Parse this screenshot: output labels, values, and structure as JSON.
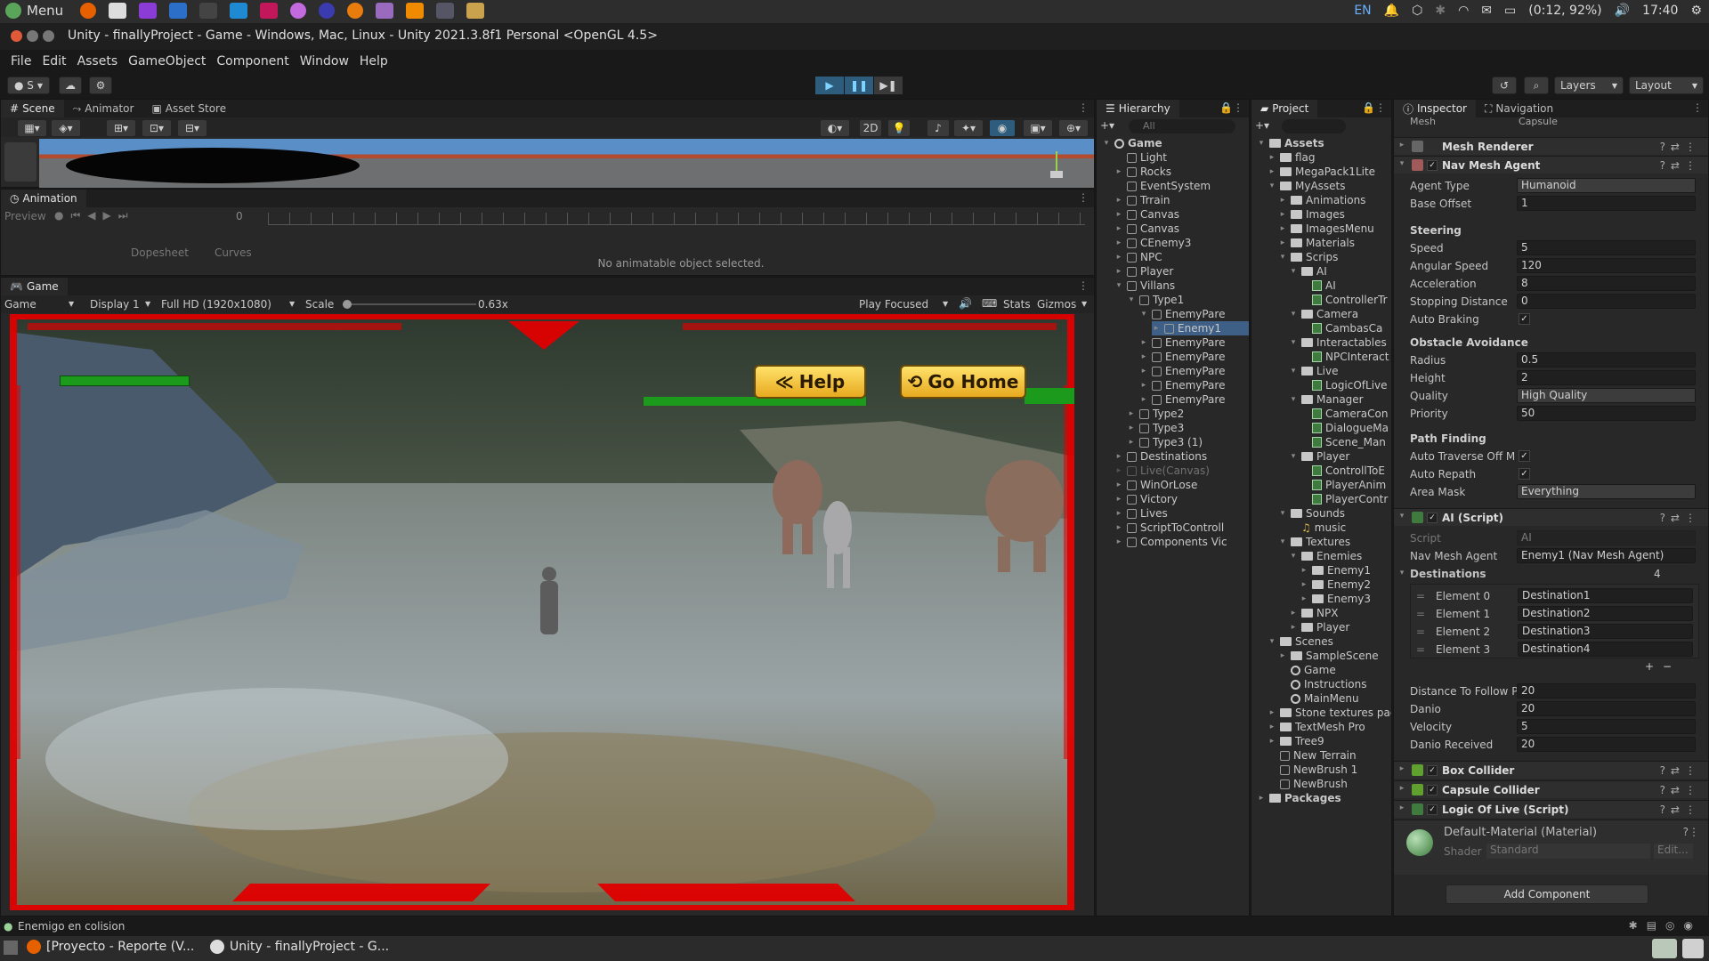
{
  "os": {
    "menu_label": "Menu",
    "tray": {
      "lang": "EN",
      "battery": "(0:12, 92%)",
      "time": "17:40"
    }
  },
  "window": {
    "title": "Unity - finallyProject - Game - Windows, Mac, Linux - Unity 2021.3.8f1 Personal <OpenGL 4.5>"
  },
  "menu": [
    "File",
    "Edit",
    "Assets",
    "GameObject",
    "Component",
    "Window",
    "Help"
  ],
  "toolbar": {
    "account": "S",
    "layers": "Layers",
    "layout": "Layout"
  },
  "scene_panel": {
    "tabs": [
      "Scene",
      "Animator",
      "Asset Store"
    ],
    "mode_2d": "2D"
  },
  "animation_panel": {
    "tab": "Animation",
    "preview": "Preview",
    "frame": "0",
    "dopesheet": "Dopesheet",
    "curves": "Curves",
    "message": "No animatable object selected."
  },
  "game_panel": {
    "tab": "Game",
    "view": "Game",
    "display": "Display 1",
    "resolution": "Full HD (1920x1080)",
    "scale_label": "Scale",
    "scale_value": "0.63x",
    "play_mode": "Play Focused",
    "stats": "Stats",
    "gizmos": "Gizmos",
    "help_button": "Help",
    "home_button": "Go Home"
  },
  "hierarchy": {
    "tab": "Hierarchy",
    "search_placeholder": "All",
    "items": [
      "Game",
      "Light",
      "Rocks",
      "EventSystem",
      "Trrain",
      "Canvas",
      "Canvas",
      "CEnemy3",
      "NPC",
      "Player",
      "Villans",
      "Type1",
      "EnemyPare",
      "Enemy1",
      "EnemyPare",
      "EnemyPare",
      "EnemyPare",
      "EnemyPare",
      "EnemyPare",
      "Type2",
      "Type3",
      "Type3 (1)",
      "Destinations",
      "Live(Canvas)",
      "WinOrLose",
      "Victory",
      "Lives",
      "ScriptToControll",
      "Components Vic"
    ]
  },
  "project": {
    "tab": "Project",
    "items": [
      "Assets",
      "flag",
      "MegaPack1Lite",
      "MyAssets",
      "Animations",
      "Images",
      "ImagesMenu",
      "Materials",
      "Scrips",
      "AI",
      "AI",
      "ControllerTr",
      "Camera",
      "CambasCa",
      "Interactables",
      "NPCInteract",
      "Live",
      "LogicOfLive",
      "Manager",
      "CameraCon",
      "DialogueMa",
      "Scene_Man",
      "Player",
      "ControllToE",
      "PlayerAnim",
      "PlayerContr",
      "Sounds",
      "music",
      "Textures",
      "Enemies",
      "Enemy1",
      "Enemy2",
      "Enemy3",
      "NPX",
      "Player",
      "Scenes",
      "SampleScene",
      "Game",
      "Instructions",
      "MainMenu",
      "Stone textures pack",
      "TextMesh Pro",
      "Tree9",
      "New Terrain",
      "NewBrush 1",
      "NewBrush",
      "Packages"
    ]
  },
  "inspector": {
    "tabs": [
      "Inspector",
      "Navigation"
    ],
    "mesh_label": "Mesh",
    "mesh_value": "Capsule",
    "components": {
      "mesh_renderer": "Mesh Renderer",
      "nav_mesh_agent": "Nav Mesh Agent",
      "ai_script": "AI (Script)",
      "box_collider": "Box Collider",
      "capsule_collider": "Capsule Collider",
      "logic_of_live": "Logic Of Live (Script)"
    },
    "nav": {
      "agent_type_label": "Agent Type",
      "agent_type": "Humanoid",
      "base_offset_label": "Base Offset",
      "base_offset": "1",
      "steering": "Steering",
      "speed_label": "Speed",
      "speed": "5",
      "angular_speed_label": "Angular Speed",
      "angular_speed": "120",
      "acceleration_label": "Acceleration",
      "acceleration": "8",
      "stopping_label": "Stopping Distance",
      "stopping": "0",
      "auto_braking_label": "Auto Braking",
      "obstacle": "Obstacle Avoidance",
      "radius_label": "Radius",
      "radius": "0.5",
      "height_label": "Height",
      "height": "2",
      "quality_label": "Quality",
      "quality": "High Quality",
      "priority_label": "Priority",
      "priority": "50",
      "path_finding": "Path Finding",
      "auto_traverse_label": "Auto Traverse Off M",
      "auto_repath_label": "Auto Repath",
      "area_mask_label": "Area Mask",
      "area_mask": "Everything"
    },
    "ai": {
      "script_label": "Script",
      "script": "AI",
      "nav_agent_label": "Nav Mesh Agent",
      "nav_agent": "Enemy1 (Nav Mesh Agent)",
      "destinations_label": "Destinations",
      "destinations_count": "4",
      "elements": [
        {
          "label": "Element 0",
          "value": "Destination1"
        },
        {
          "label": "Element 1",
          "value": "Destination2"
        },
        {
          "label": "Element 2",
          "value": "Destination3"
        },
        {
          "label": "Element 3",
          "value": "Destination4"
        }
      ],
      "distance_label": "Distance To Follow P",
      "distance": "20",
      "danio_label": "Danio",
      "danio": "20",
      "velocity_label": "Velocity",
      "velocity": "5",
      "danio_received_label": "Danio Received",
      "danio_received": "20"
    },
    "material": {
      "name": "Default-Material (Material)",
      "shader_label": "Shader",
      "shader": "Standard",
      "edit": "Edit..."
    },
    "add_component": "Add Component"
  },
  "status": {
    "message": "Enemigo en colision"
  },
  "taskbar": {
    "task1": "[Proyecto - Reporte (V...",
    "task2": "Unity - finallyProject - G..."
  },
  "colors": {
    "accent_play": "#2d5c7c",
    "script_green": "#3f7a3f",
    "hud_red": "#e00000",
    "health_green": "#1c9a1c",
    "button_yellow": "#f2c12e"
  }
}
